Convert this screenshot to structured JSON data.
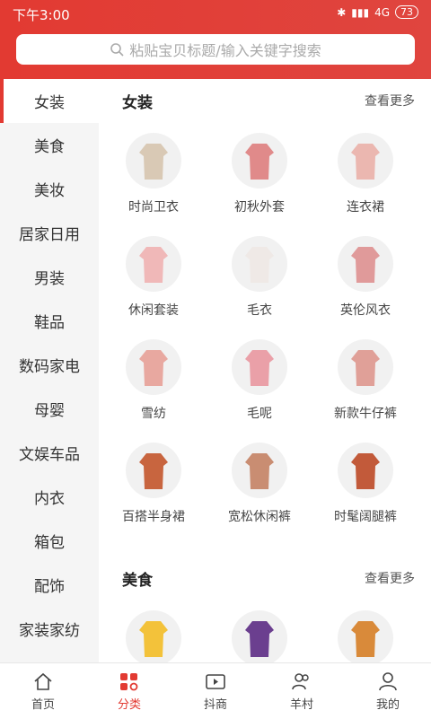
{
  "status": {
    "time": "下午3:00",
    "network": "4G",
    "battery": "73"
  },
  "search": {
    "placeholder": "粘贴宝贝标题/输入关键字搜索"
  },
  "sidebar": {
    "items": [
      {
        "label": "女装",
        "active": true
      },
      {
        "label": "美食"
      },
      {
        "label": "美妆"
      },
      {
        "label": "居家日用"
      },
      {
        "label": "男装"
      },
      {
        "label": "鞋品"
      },
      {
        "label": "数码家电"
      },
      {
        "label": "母婴"
      },
      {
        "label": "文娱车品"
      },
      {
        "label": "内衣"
      },
      {
        "label": "箱包"
      },
      {
        "label": "配饰"
      },
      {
        "label": "家装家纺"
      }
    ]
  },
  "sections": [
    {
      "title": "女装",
      "more": "查看更多",
      "items": [
        {
          "label": "时尚卫衣",
          "icon": "hoodie-icon",
          "color": "#d9c9b5"
        },
        {
          "label": "初秋外套",
          "icon": "jacket-icon",
          "color": "#e08a8a"
        },
        {
          "label": "连衣裙",
          "icon": "dress-icon",
          "color": "#ebb7b0"
        },
        {
          "label": "休闲套装",
          "icon": "suit-icon",
          "color": "#f0b8b8"
        },
        {
          "label": "毛衣",
          "icon": "sweater-icon",
          "color": "#efe9e6"
        },
        {
          "label": "英伦风衣",
          "icon": "trenchcoat-icon",
          "color": "#e09a9a"
        },
        {
          "label": "雪纺",
          "icon": "chiffon-icon",
          "color": "#e8a8a0"
        },
        {
          "label": "毛呢",
          "icon": "wool-coat-icon",
          "color": "#eaa0a8"
        },
        {
          "label": "新款牛仔裤",
          "icon": "overalls-icon",
          "color": "#e0a098"
        },
        {
          "label": "百搭半身裙",
          "icon": "skirt-icon",
          "color": "#c8653f"
        },
        {
          "label": "宽松休闲裤",
          "icon": "pants-icon",
          "color": "#c98d72"
        },
        {
          "label": "时髦阔腿裤",
          "icon": "wide-pants-icon",
          "color": "#c25a3a"
        }
      ]
    },
    {
      "title": "美食",
      "more": "查看更多",
      "items": [
        {
          "label": "",
          "icon": "snack-bag-icon",
          "color": "#f3c23a"
        },
        {
          "label": "",
          "icon": "noodle-icon",
          "color": "#6b3f8f"
        },
        {
          "label": "",
          "icon": "bread-icon",
          "color": "#d98a3a"
        }
      ]
    }
  ],
  "tabbar": [
    {
      "label": "首页",
      "icon": "home-icon"
    },
    {
      "label": "分类",
      "icon": "category-icon",
      "active": true
    },
    {
      "label": "抖商",
      "icon": "video-icon"
    },
    {
      "label": "羊村",
      "icon": "people-icon"
    },
    {
      "label": "我的",
      "icon": "user-icon"
    }
  ]
}
